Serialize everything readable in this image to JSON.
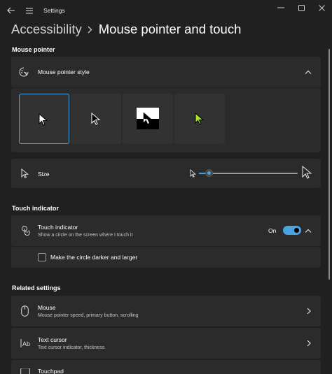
{
  "window": {
    "app_title": "Settings",
    "minimize_glyph": "—",
    "maximize_glyph": "☐",
    "close_glyph": "✕"
  },
  "header": {
    "breadcrumb_parent": "Accessibility",
    "breadcrumb_current": "Mouse pointer and touch"
  },
  "mouse_pointer": {
    "section_label": "Mouse pointer",
    "style_row_label": "Mouse pointer style",
    "style_tiles": [
      {
        "name": "white",
        "selected": true
      },
      {
        "name": "black",
        "selected": false
      },
      {
        "name": "inverted",
        "selected": false
      },
      {
        "name": "custom",
        "selected": false,
        "color": "#a8e22a"
      }
    ],
    "size_label": "Size",
    "size_value_fraction": 0.1
  },
  "touch_indicator": {
    "section_label": "Touch indicator",
    "title": "Touch indicator",
    "subtitle": "Show a circle on the screen where I touch it",
    "toggle_state_label": "On",
    "toggle_on": true,
    "checkbox_label": "Make the circle darker and larger",
    "checkbox_checked": false
  },
  "related_settings": {
    "section_label": "Related settings",
    "items": [
      {
        "title": "Mouse",
        "subtitle": "Mouse pointer speed, primary button, scrolling",
        "icon": "mouse-icon"
      },
      {
        "title": "Text cursor",
        "subtitle": "Text cursor indicator, thickness",
        "icon": "text-cursor-icon"
      },
      {
        "title": "Touchpad",
        "subtitle": "",
        "icon": "touchpad-icon"
      }
    ]
  },
  "colors": {
    "accent": "#4aa3df",
    "background": "#202020",
    "card": "#2b2b2b"
  }
}
